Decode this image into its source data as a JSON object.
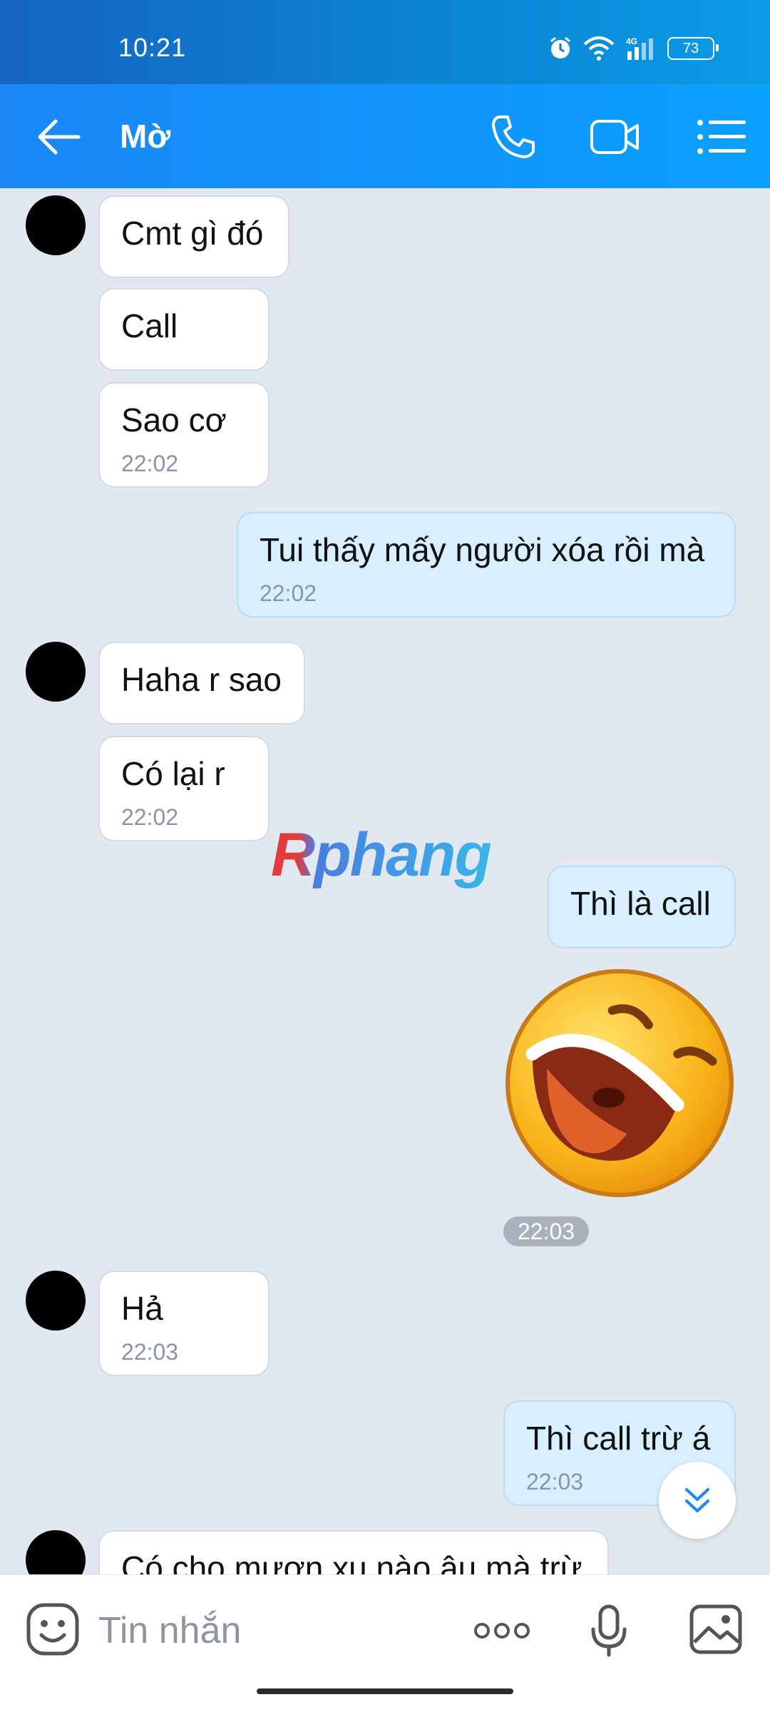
{
  "status_bar": {
    "time": "10:21",
    "battery": "73",
    "network": "4G"
  },
  "header": {
    "title": "Mờ"
  },
  "messages": [
    {
      "text": "Cmt gì đó"
    },
    {
      "text": "Call"
    },
    {
      "text": "Sao cơ",
      "time": "22:02"
    },
    {
      "text": "Tui thấy mấy người xóa rồi mà",
      "time": "22:02"
    },
    {
      "text": "Haha r sao"
    },
    {
      "text": "Có lại r",
      "time": "22:02"
    },
    {
      "text": "Thì là call"
    },
    {
      "sticker": "laughing-face-sticker",
      "time": "22:03"
    },
    {
      "text": "Hả",
      "time": "22:03"
    },
    {
      "text": "Thì call trừ á",
      "time": "22:03"
    },
    {
      "text": "Có cho mượn xu nào âu mà trừ"
    }
  ],
  "watermark": "Rphang",
  "composer": {
    "placeholder": "Tin nhắn"
  },
  "colors": {
    "header": "#0aa0ff",
    "incoming": "#ffffff",
    "outgoing": "#d7efff",
    "background": "#e2e8f0"
  }
}
